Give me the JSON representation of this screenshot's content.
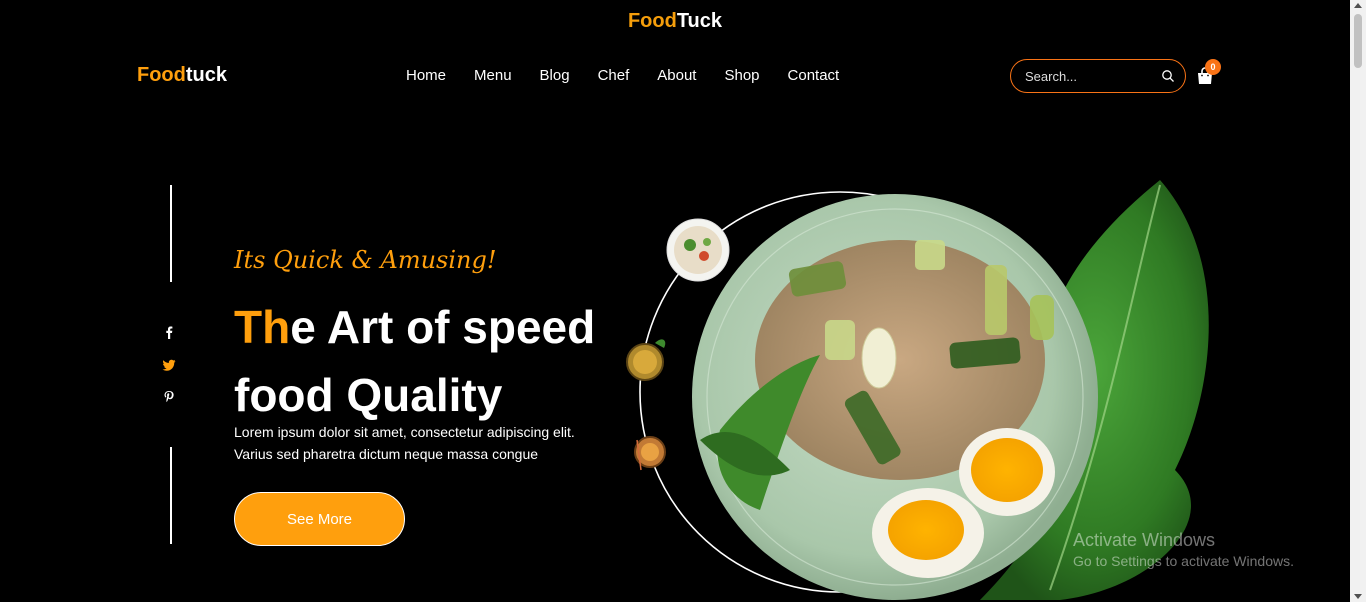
{
  "site": {
    "top_brand_a": "Food",
    "top_brand_b": "Tuck",
    "logo_a": "Food",
    "logo_b": "tuck"
  },
  "nav": {
    "items": [
      "Home",
      "Menu",
      "Blog",
      "Chef",
      "About",
      "Shop",
      "Contact"
    ]
  },
  "search": {
    "placeholder": "Search...",
    "icon": "search-icon"
  },
  "cart": {
    "count": "0",
    "icon": "shopping-bag-icon"
  },
  "social": [
    "facebook-icon",
    "twitter-icon",
    "pinterest-icon"
  ],
  "hero": {
    "tagline": "Its Quick & Amusing!",
    "headline_accent": "Th",
    "headline_line1_rest": "e Art of speed",
    "headline_line2": "food Quality",
    "desc_line1": "Lorem ipsum dolor sit amet, consectetur adipiscing elit.",
    "desc_line2": "Varius sed pharetra dictum neque massa congue",
    "button_label": "See More"
  },
  "watermark": {
    "line1": "Activate Windows",
    "line2": "Go to Settings to activate Windows."
  },
  "colors": {
    "accent": "#ff9f0d",
    "search_border": "#f97316",
    "background": "#000000"
  }
}
